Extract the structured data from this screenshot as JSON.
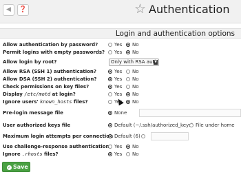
{
  "header": {
    "back_icon": "chevron-left-icon",
    "help_icon": "help-circle-icon",
    "star_icon": "star-outline-icon",
    "title": "Authentication"
  },
  "section": {
    "title": "Login and authentication options"
  },
  "rows": [
    {
      "label": "Allow authentication by password?",
      "options": [
        "Yes",
        "No"
      ],
      "selected": "No"
    },
    {
      "label": "Permit logins with empty passwords?",
      "options": [
        "Yes",
        "No"
      ],
      "selected": "No"
    },
    {
      "label": "Allow login by root?",
      "select_value": "Only with RSA auth"
    },
    {
      "label": "Allow RSA (SSH 1) authentication?",
      "options": [
        "Yes",
        "No"
      ],
      "selected": "Yes"
    },
    {
      "label": "Allow DSA (SSH 2) authentication?",
      "options": [
        "Yes",
        "No"
      ],
      "selected": "Yes"
    },
    {
      "label": "Check permissions on key files?",
      "options": [
        "Yes",
        "No"
      ],
      "selected": "Yes"
    },
    {
      "label_prefix": "Display ",
      "label_code": "/etc/motd",
      "label_suffix": " at login?",
      "options": [
        "Yes",
        "No"
      ],
      "selected": "No"
    },
    {
      "label_prefix": "Ignore users' ",
      "label_code": "known_hosts",
      "label_suffix": " files?",
      "options": [
        "Yes",
        "No"
      ],
      "selected": "No"
    },
    {
      "label": "Pre-login message file",
      "options": [
        "None"
      ],
      "selected": "None"
    },
    {
      "label": "User authorized keys file",
      "options": [
        "Default (~/.ssh/authorized_keys)",
        "File under home"
      ],
      "selected": "Default (~/.ssh/authorized_keys)"
    },
    {
      "label": "Maximum login attempts per connection",
      "options": [
        "Default (6)"
      ],
      "selected": "Default (6)"
    },
    {
      "label": "Use challenge-response authentication?",
      "options": [
        "Yes",
        "No"
      ],
      "selected": "No"
    },
    {
      "label_prefix": "Ignore ",
      "label_code": ".rhosts",
      "label_suffix": " files?",
      "options": [
        "Yes",
        "No"
      ],
      "selected": "Yes"
    }
  ],
  "footer": {
    "save_label": "Save",
    "save_icon": "check-circle-icon"
  },
  "colors": {
    "save_button": "#4aa143",
    "header_bg": "#f1f1f1"
  }
}
